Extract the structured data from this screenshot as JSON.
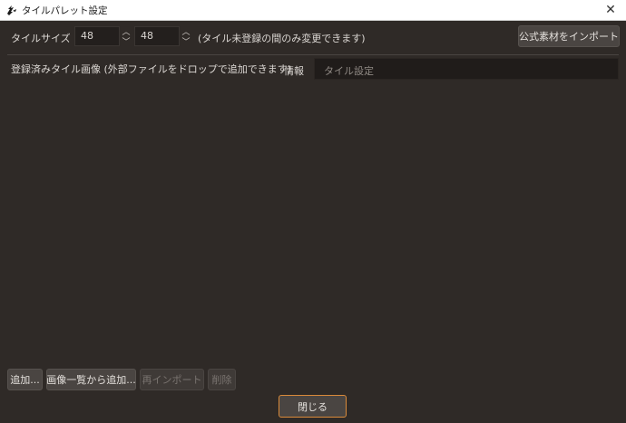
{
  "window": {
    "title": "タイルパレット設定",
    "close_glyph": "✕"
  },
  "tile_size": {
    "label": "タイルサイズ",
    "width": "48",
    "height": "48",
    "note": "(タイル未登録の間のみ変更できます)"
  },
  "import_button": "公式素材をインポート",
  "list_label": "登録済みタイル画像 (外部ファイルをドロップで追加できます)",
  "info": {
    "label": "情報",
    "placeholder": "タイル設定"
  },
  "buttons": {
    "add": "追加...",
    "add_from_list": "画像一覧から追加...",
    "reimport": "再インポート",
    "delete": "削除"
  },
  "close_button": "閉じる",
  "colors": {
    "background": "#2f2a27",
    "accent": "#d98a3a"
  }
}
